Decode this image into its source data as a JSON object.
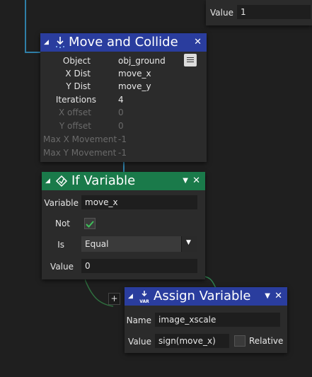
{
  "top_field": {
    "label": "Value",
    "value": "1"
  },
  "move_collide": {
    "title": "Move and Collide",
    "rows": [
      {
        "label": "Object",
        "value": "obj_ground"
      },
      {
        "label": "X Dist",
        "value": "move_x"
      },
      {
        "label": "Y Dist",
        "value": "move_y"
      },
      {
        "label": "Iterations",
        "value": "4"
      },
      {
        "label": "X offset",
        "value": "0"
      },
      {
        "label": "Y offset",
        "value": "0"
      },
      {
        "label": "Max X Movement",
        "value": "-1"
      },
      {
        "label": "Max Y Movement",
        "value": "-1"
      }
    ]
  },
  "if_variable": {
    "title": "If Variable",
    "variable_label": "Variable",
    "variable_value": "move_x",
    "not_label": "Not",
    "not_checked": true,
    "is_label": "Is",
    "is_value": "Equal",
    "value_label": "Value",
    "value_value": "0"
  },
  "assign_variable": {
    "title": "Assign Variable",
    "icon_text": "VAR",
    "name_label": "Name",
    "name_value": "image_xscale",
    "value_label": "Value",
    "value_value": "sign(move_x)",
    "relative_label": "Relative",
    "relative_checked": false
  },
  "add_button": "+",
  "colors": {
    "move_header": "#2a3d9e",
    "if_header": "#1a7a4a",
    "assign_header": "#2a3d9e",
    "wire": "#2f7fa7",
    "check_green": "#3fbf5a"
  }
}
